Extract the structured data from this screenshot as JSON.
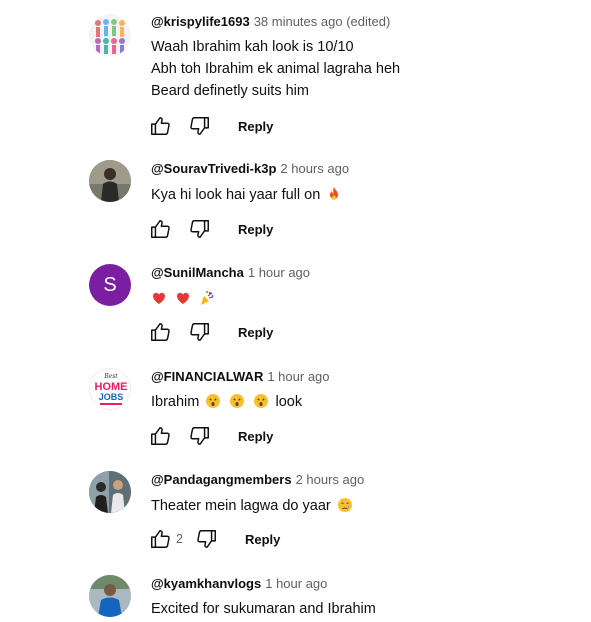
{
  "reply_label": "Reply",
  "colors": {
    "author": "#0f0f0f",
    "timestamp": "#606060",
    "avatar_s": "#7b1fa2"
  },
  "icons": {
    "like": "thumbs-up-icon",
    "dislike": "thumbs-down-icon"
  },
  "comments": [
    {
      "author": "@krispylife1693",
      "time": "38 minutes ago (edited)",
      "lines": [
        "Waah Ibrahim kah look is 10/10",
        "Abh toh Ibrahim ek animal lagraha heh",
        "Beard definetly suits him"
      ],
      "likes": ""
    },
    {
      "author": "@SouravTrivedi-k3p",
      "time": "2 hours ago",
      "text": "Kya hi look hai yaar full on",
      "likes": ""
    },
    {
      "author": "@SunilMancha",
      "time": "1 hour ago",
      "avatar_letter": "S",
      "likes": ""
    },
    {
      "author": "@FINANCIALWAR",
      "time": "1 hour ago",
      "text_before": "Ibrahim",
      "text_after": "look",
      "avatar_text": {
        "line1": "Best",
        "line2": "HOME",
        "line3": "JOBS"
      },
      "likes": ""
    },
    {
      "author": "@Pandagangmembers",
      "time": "2 hours ago",
      "text": "Theater mein lagwa do yaar",
      "likes": "2"
    },
    {
      "author": "@kyamkhanvlogs",
      "time": "1 hour ago",
      "text": "Excited for sukumaran and Ibrahim"
    }
  ]
}
